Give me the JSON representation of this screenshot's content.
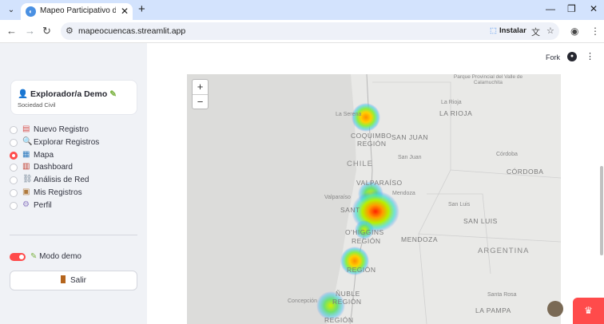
{
  "browser": {
    "tab_title": "Mapeo Participativo de Cuencas",
    "url": "mapeocuencas.streamlit.app",
    "install_label": "Instalar"
  },
  "header": {
    "fork_label": "Fork"
  },
  "sidebar": {
    "user": {
      "name": "Explorador/a Demo",
      "role": "Sociedad Civil"
    },
    "nav_items": [
      {
        "label": "Nuevo Registro",
        "icon": "memo-icon",
        "selected": false
      },
      {
        "label": "Explorar Registros",
        "icon": "magnifier-icon",
        "selected": false
      },
      {
        "label": "Mapa",
        "icon": "map-icon",
        "selected": true
      },
      {
        "label": "Dashboard",
        "icon": "bar-chart-icon",
        "selected": false
      },
      {
        "label": "Análisis de Red",
        "icon": "link-icon",
        "selected": false
      },
      {
        "label": "Mis Registros",
        "icon": "clipboard-icon",
        "selected": false
      },
      {
        "label": "Perfil",
        "icon": "gear-icon",
        "selected": false
      }
    ],
    "demo_toggle_label": "Modo demo",
    "demo_toggle_on": true,
    "logout_label": "Salir"
  },
  "map": {
    "labels": [
      {
        "text": "Parque Provincial del Valle de Calamuchita",
        "kind": "small"
      },
      {
        "text": "La Rioja",
        "kind": "small"
      },
      {
        "text": "LA RIOJA",
        "kind": "big"
      },
      {
        "text": "La Serena",
        "kind": "small"
      },
      {
        "text": "COQUIMBO",
        "kind": "big"
      },
      {
        "text": "REGIÓN",
        "kind": "big"
      },
      {
        "text": "SAN JUAN",
        "kind": "big"
      },
      {
        "text": "San Juan",
        "kind": "small"
      },
      {
        "text": "CÓRDOBA",
        "kind": "big"
      },
      {
        "text": "Córdoba",
        "kind": "small"
      },
      {
        "text": "CHILE",
        "kind": "country"
      },
      {
        "text": "VALPARAÍSO",
        "kind": "big"
      },
      {
        "text": "Valparaíso",
        "kind": "small"
      },
      {
        "text": "Mendoza",
        "kind": "small"
      },
      {
        "text": "San Luis",
        "kind": "small"
      },
      {
        "text": "SAN LUIS",
        "kind": "big"
      },
      {
        "text": "SANT",
        "kind": "big"
      },
      {
        "text": "O'HIGGINS",
        "kind": "big"
      },
      {
        "text": "REGIÓN",
        "kind": "big"
      },
      {
        "text": "MENDOZA",
        "kind": "big"
      },
      {
        "text": "ARGENTINA",
        "kind": "country"
      },
      {
        "text": "REGIÓN",
        "kind": "big"
      },
      {
        "text": "Santa Rosa",
        "kind": "small"
      },
      {
        "text": "Concepción",
        "kind": "small"
      },
      {
        "text": "ÑUBLE",
        "kind": "big"
      },
      {
        "text": "REGIÓN",
        "kind": "big"
      },
      {
        "text": "LA PAMPA",
        "kind": "big"
      },
      {
        "text": "REGIÓN",
        "kind": "big"
      }
    ],
    "heat_intensities": [
      0.55,
      0.6,
      1.0,
      0.45,
      0.7,
      0.6
    ]
  }
}
